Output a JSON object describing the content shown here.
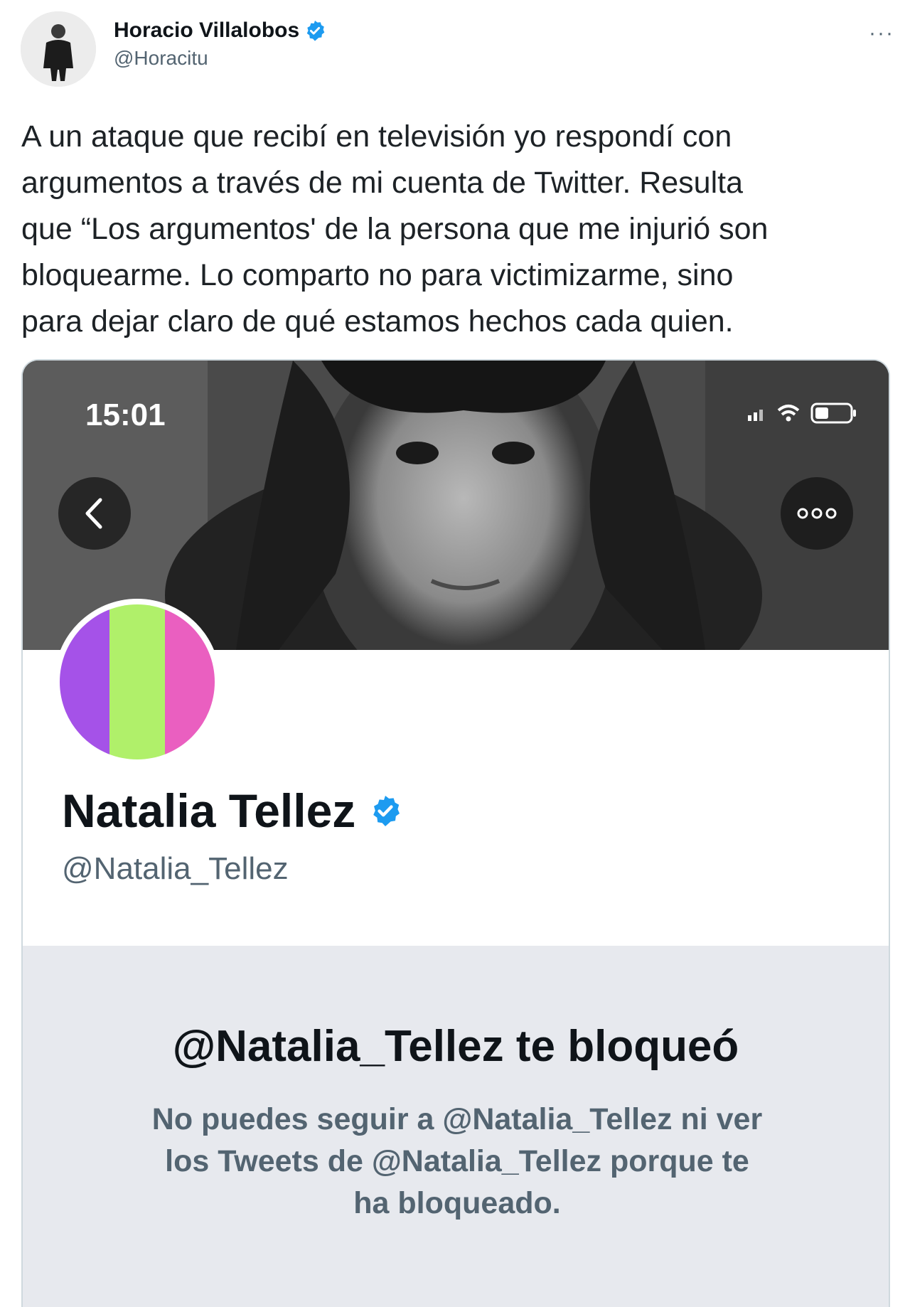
{
  "tweet": {
    "author_name": "Horacio Villalobos",
    "author_handle": "@Horacitu",
    "more_label": "···",
    "text_lines": [
      "A un ataque que recibí en televisión yo respondí con",
      "argumentos a través de mi cuenta de Twitter. Resulta",
      "que “Los argumentos' de la persona que me injurió son",
      "bloquearme. Lo comparto no para victimizarme, sino",
      "para dejar claro de qué estamos hechos cada quien."
    ]
  },
  "screenshot": {
    "status_time": "15:01",
    "profile_name": "Natalia Tellez",
    "profile_handle": "@Natalia_Tellez",
    "avatar_colors": [
      "#a552e8",
      "#b0f06a",
      "#ea5fc0"
    ],
    "blocked_title": "@Natalia_Tellez te bloqueó",
    "blocked_lines": [
      "No puedes seguir a @Natalia_Tellez ni ver",
      "los Tweets de @Natalia_Tellez porque te",
      "ha bloqueado."
    ]
  },
  "colors": {
    "verified": "#1d9bf0",
    "secondary_text": "#536471",
    "blocked_bg": "#e7e9ee"
  },
  "icons": [
    "verified-badge-icon",
    "more-icon",
    "back-chevron-icon",
    "ellipsis-icon",
    "signal-icon",
    "wifi-icon",
    "battery-icon"
  ]
}
